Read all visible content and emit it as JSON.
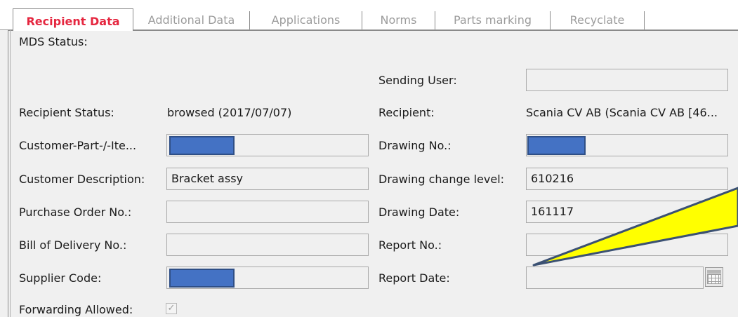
{
  "tabs": [
    {
      "label": "Recipient Data",
      "active": true
    },
    {
      "label": "Additional Data",
      "active": false
    },
    {
      "label": "Applications",
      "active": false
    },
    {
      "label": "Norms",
      "active": false
    },
    {
      "label": "Parts marking",
      "active": false
    },
    {
      "label": "Recyclate",
      "active": false
    }
  ],
  "form": {
    "mds_status_label": "MDS Status:",
    "sending_user_label": "Sending User:",
    "sending_user_value": "",
    "recipient_status_label": "Recipient Status:",
    "recipient_status_value": "browsed (2017/07/07)",
    "recipient_label": "Recipient:",
    "recipient_value": "Scania CV AB (Scania CV AB [46...",
    "customer_part_label": "Customer-Part-/-Ite...",
    "customer_part_value": "",
    "drawing_no_label": "Drawing No.:",
    "drawing_no_value": "",
    "customer_description_label": "Customer Description:",
    "customer_description_value": "Bracket assy",
    "drawing_change_level_label": "Drawing change level:",
    "drawing_change_level_value": "610216",
    "purchase_order_label": "Purchase Order No.:",
    "purchase_order_value": "",
    "drawing_date_label": "Drawing Date:",
    "drawing_date_value": "161117",
    "bill_of_delivery_label": "Bill of Delivery No.:",
    "bill_of_delivery_value": "",
    "report_no_label": "Report No.:",
    "report_no_value": "",
    "supplier_code_label": "Supplier Code:",
    "supplier_code_value": "",
    "report_date_label": "Report Date:",
    "report_date_value": "",
    "forwarding_allowed_label": "Forwarding Allowed:",
    "forwarding_allowed_checked": true
  },
  "icons": {
    "calendar": "calendar-icon",
    "checkmark": "✓"
  },
  "colors": {
    "active_tab_text": "#e5263f",
    "inactive_tab_text": "#9c9c9c",
    "redaction": "#4472c4",
    "callout_fill": "#ffff00"
  }
}
